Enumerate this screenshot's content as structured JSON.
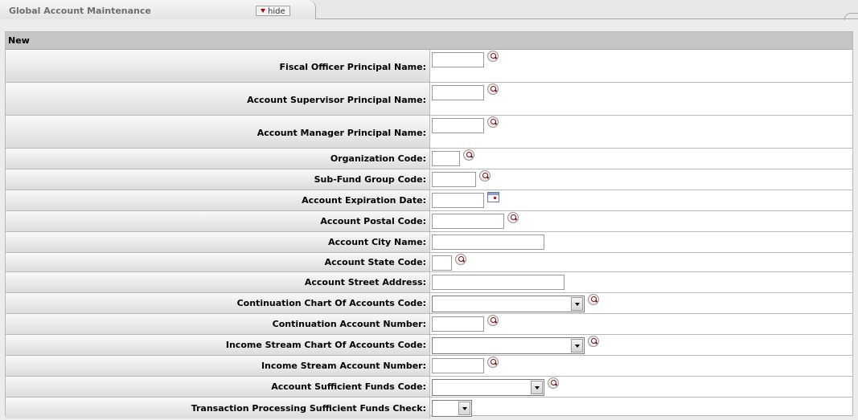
{
  "tab": {
    "title": "Global Account Maintenance",
    "hide_label": "hide"
  },
  "section": {
    "title": "New"
  },
  "fields": {
    "fiscal_officer": {
      "label": "Fiscal Officer Principal Name:",
      "value": ""
    },
    "account_supervisor": {
      "label": "Account Supervisor Principal Name:",
      "value": ""
    },
    "account_manager": {
      "label": "Account Manager Principal Name:",
      "value": ""
    },
    "organization_code": {
      "label": "Organization Code:",
      "value": ""
    },
    "sub_fund_group": {
      "label": "Sub-Fund Group Code:",
      "value": ""
    },
    "expiration_date": {
      "label": "Account Expiration Date:",
      "value": ""
    },
    "postal_code": {
      "label": "Account Postal Code:",
      "value": ""
    },
    "city_name": {
      "label": "Account City Name:",
      "value": ""
    },
    "state_code": {
      "label": "Account State Code:",
      "value": ""
    },
    "street_address": {
      "label": "Account Street Address:",
      "value": ""
    },
    "continuation_chart": {
      "label": "Continuation Chart Of Accounts Code:",
      "value": ""
    },
    "continuation_account": {
      "label": "Continuation Account Number:",
      "value": ""
    },
    "income_chart": {
      "label": "Income Stream Chart Of Accounts Code:",
      "value": ""
    },
    "income_account": {
      "label": "Income Stream Account Number:",
      "value": ""
    },
    "sufficient_funds_code": {
      "label": "Account Sufficient Funds Code:",
      "value": ""
    },
    "tp_sufficient_funds_check": {
      "label": "Transaction Processing Sufficient Funds Check:",
      "value": ""
    }
  }
}
